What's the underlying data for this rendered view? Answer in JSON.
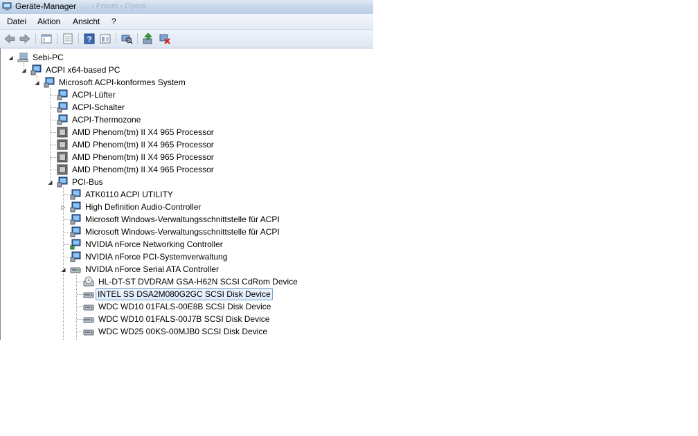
{
  "window": {
    "title": "Geräte-Manager",
    "ghost_title": "… › Forum › Opera"
  },
  "menu": [
    "Datei",
    "Aktion",
    "Ansicht",
    "?"
  ],
  "toolbar": {
    "buttons": [
      "back-arrow-icon",
      "forward-arrow-icon",
      "properties-sheet-icon",
      "console-tree-icon",
      "help-icon",
      "show-hidden-icon",
      "scan-hardware-icon",
      "update-driver-icon",
      "uninstall-device-icon"
    ]
  },
  "tree": [
    {
      "label": "Sebi-PC",
      "icon": "computer-icon",
      "expanded": true
    },
    {
      "label": "ACPI x64-based PC",
      "icon": "system-device-icon",
      "expanded": true
    },
    {
      "label": "Microsoft ACPI-konformes System",
      "icon": "system-device-icon",
      "expanded": true
    },
    {
      "label": "ACPI-Lüfter",
      "icon": "system-device-icon"
    },
    {
      "label": "ACPI-Schalter",
      "icon": "system-device-icon"
    },
    {
      "label": "ACPI-Thermozone",
      "icon": "system-device-icon"
    },
    {
      "label": "AMD Phenom(tm) II X4 965 Processor",
      "icon": "processor-icon"
    },
    {
      "label": "AMD Phenom(tm) II X4 965 Processor",
      "icon": "processor-icon"
    },
    {
      "label": "AMD Phenom(tm) II X4 965 Processor",
      "icon": "processor-icon"
    },
    {
      "label": "AMD Phenom(tm) II X4 965 Processor",
      "icon": "processor-icon"
    },
    {
      "label": "PCI-Bus",
      "icon": "system-device-icon",
      "expanded": true
    },
    {
      "label": "ATK0110 ACPI UTILITY",
      "icon": "system-device-icon"
    },
    {
      "label": "High Definition Audio-Controller",
      "icon": "system-device-icon",
      "expanded": false
    },
    {
      "label": "Microsoft Windows-Verwaltungsschnittstelle für ACPI",
      "icon": "system-device-icon"
    },
    {
      "label": "Microsoft Windows-Verwaltungsschnittstelle für ACPI",
      "icon": "system-device-icon"
    },
    {
      "label": "NVIDIA nForce Networking Controller",
      "icon": "network-adapter-icon"
    },
    {
      "label": "NVIDIA nForce PCI-Systemverwaltung",
      "icon": "system-device-icon"
    },
    {
      "label": "NVIDIA nForce Serial ATA Controller",
      "icon": "storage-controller-icon",
      "expanded": true
    },
    {
      "label": "HL-DT-ST DVDRAM GSA-H62N SCSI CdRom Device",
      "icon": "cdrom-drive-icon"
    },
    {
      "label": "INTEL SS DSA2M080G2GC SCSI Disk Device",
      "icon": "disk-drive-icon",
      "selected": true
    },
    {
      "label": "WDC WD10 01FALS-00E8B SCSI Disk Device",
      "icon": "disk-drive-icon"
    },
    {
      "label": "WDC WD10 01FALS-00J7B SCSI Disk Device",
      "icon": "disk-drive-icon"
    },
    {
      "label": "WDC WD25 00KS-00MJB0 SCSI Disk Device",
      "icon": "disk-drive-icon"
    }
  ]
}
